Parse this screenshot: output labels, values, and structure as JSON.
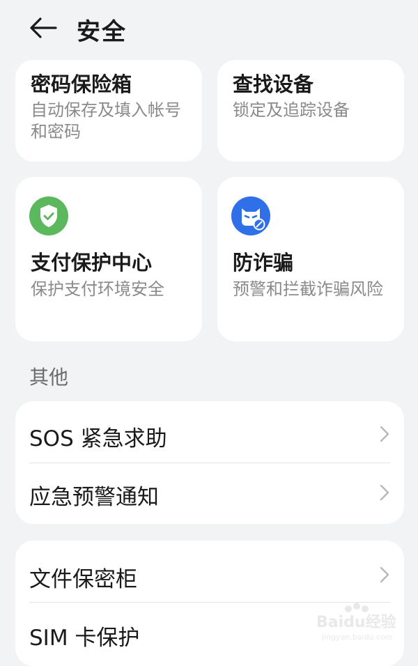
{
  "header": {
    "title": "安全"
  },
  "tiles": [
    {
      "title": "密码保险箱",
      "desc": "自动保存及填入帐号和密码"
    },
    {
      "title": "查找设备",
      "desc": "锁定及追踪设备"
    },
    {
      "title": "支付保护中心",
      "desc": "保护支付环境安全",
      "icon": "shield-check-icon",
      "icon_color": "#5cb85c"
    },
    {
      "title": "防诈骗",
      "desc": "预警和拦截诈骗风险",
      "icon": "anti-fraud-icon",
      "icon_color": "#2f6fe8"
    }
  ],
  "section": {
    "label": "其他"
  },
  "group1": [
    {
      "label": "SOS 紧急求助"
    },
    {
      "label": "应急预警通知"
    }
  ],
  "group2": [
    {
      "label": "文件保密柜"
    },
    {
      "label": "SIM 卡保护"
    }
  ],
  "watermark": {
    "line1": "Baidu经验",
    "line2": "jingyan.baidu.com"
  }
}
